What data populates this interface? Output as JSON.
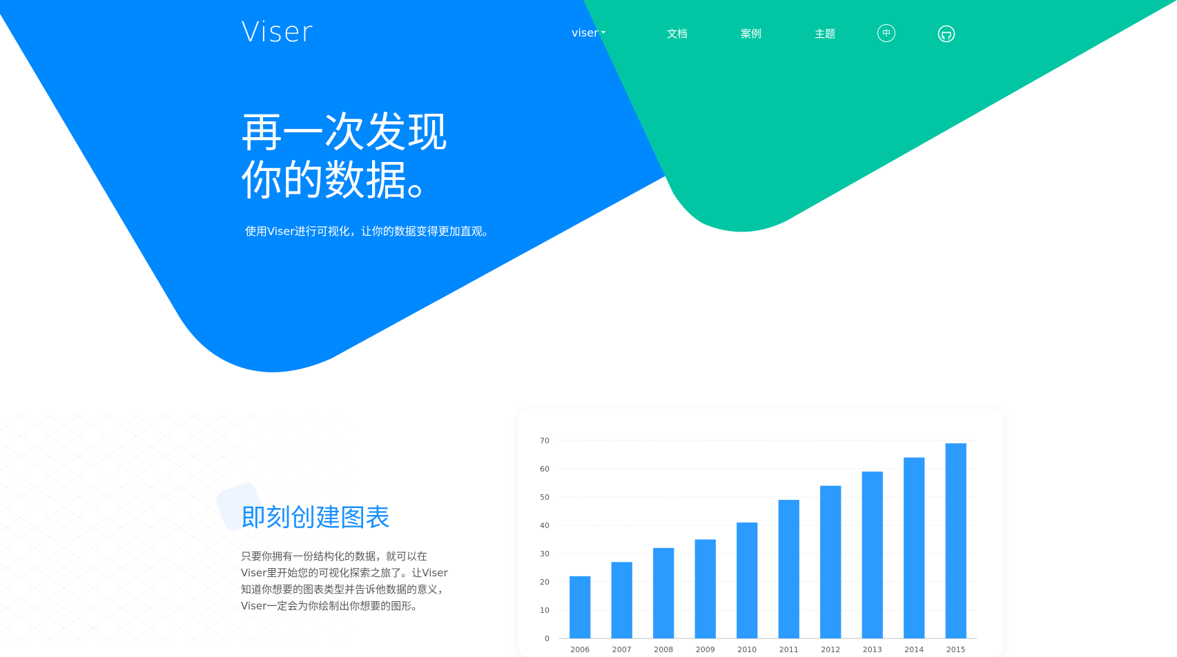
{
  "brand": {
    "logo": "Viser"
  },
  "nav": {
    "viser": "viser",
    "docs": "文档",
    "cases": "案例",
    "theme": "主题",
    "lang": "中",
    "github_icon": "github-icon"
  },
  "hero": {
    "title_line1": "再一次发现",
    "title_line2": "你的数据。",
    "subtitle": "使用Viser进行可视化，让你的数据变得更加直观。"
  },
  "feature": {
    "title": "即刻创建图表",
    "description": "只要你拥有一份结构化的数据，就可以在Viser里开始您的可视化探索之旅了。让Viser知道你想要的图表类型并告诉他数据的意义，Viser一定会为你绘制出你想要的图形。"
  },
  "colors": {
    "blue": "#0088ff",
    "green": "#02c6a3",
    "bar": "#2b9bff",
    "feature_title": "#1890ff"
  },
  "chart_data": {
    "type": "bar",
    "categories": [
      "2006",
      "2007",
      "2008",
      "2009",
      "2010",
      "2011",
      "2012",
      "2013",
      "2014",
      "2015"
    ],
    "values": [
      22,
      27,
      32,
      35,
      41,
      49,
      54,
      59,
      64,
      69
    ],
    "yticks": [
      0,
      10,
      20,
      30,
      40,
      50,
      60,
      70
    ],
    "ylim": [
      0,
      70
    ],
    "grid": true,
    "color": "#2b9bff"
  }
}
